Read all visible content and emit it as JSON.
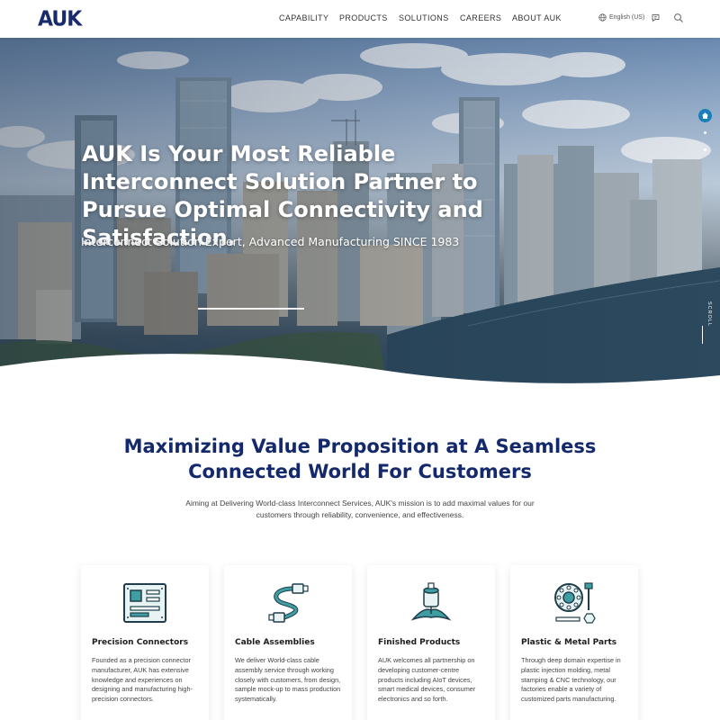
{
  "brand": {
    "logo_text": "AUK",
    "color": "#1a2b6d"
  },
  "nav": {
    "items": [
      {
        "label": "CAPABILITY"
      },
      {
        "label": "PRODUCTS"
      },
      {
        "label": "SOLUTIONS"
      },
      {
        "label": "CAREERS"
      },
      {
        "label": "ABOUT AUK"
      }
    ],
    "language": "English (US)",
    "icons": [
      "globe-icon",
      "chat-icon",
      "search-icon"
    ]
  },
  "hero": {
    "title": "AUK Is Your Most Reliable Interconnect Solution Partner to Pursue Optimal Connectivity and Satisfaction.",
    "subtitle": "Interconnect Solution Expert, Advanced Manufacturing SINCE 1983",
    "side_nav_icon": "home-icon",
    "scroll_label": "SCROLL"
  },
  "section": {
    "title_line1": "Maximizing Value Proposition at A Seamless",
    "title_line2": "Connected World For Customers",
    "description": "Aiming at Delivering World-class Interconnect Services, AUK's mission is to add maximal values for our customers through reliability, convenience, and effectiveness."
  },
  "cards": [
    {
      "icon": "circuit-board-icon",
      "title": "Precision Connectors",
      "text": "Founded as a precision connector manufacturer, AUK has extensive knowledge and experiences on designing and manufacturing high-precision connectors."
    },
    {
      "icon": "cable-icon",
      "title": "Cable Assemblies",
      "text": "We deliver World-class cable assembly service through working closely with customers, from design, sample mock-up to mass production systematically."
    },
    {
      "icon": "finished-product-icon",
      "title": "Finished Products",
      "text": "AUK welcomes all partnership on developing customer-centre products including AIoT devices, smart medical devices, consumer electronics and so forth."
    },
    {
      "icon": "metal-parts-icon",
      "title": "Plastic & Metal Parts",
      "text": "Through deep domain expertise in plastic injection molding, metal stamping & CNC technology, our factories enable a variety of customized parts manufacturing."
    }
  ],
  "colors": {
    "navy": "#14296b",
    "teal": "#2a7f86",
    "accent_blue": "#1a7fb8"
  }
}
